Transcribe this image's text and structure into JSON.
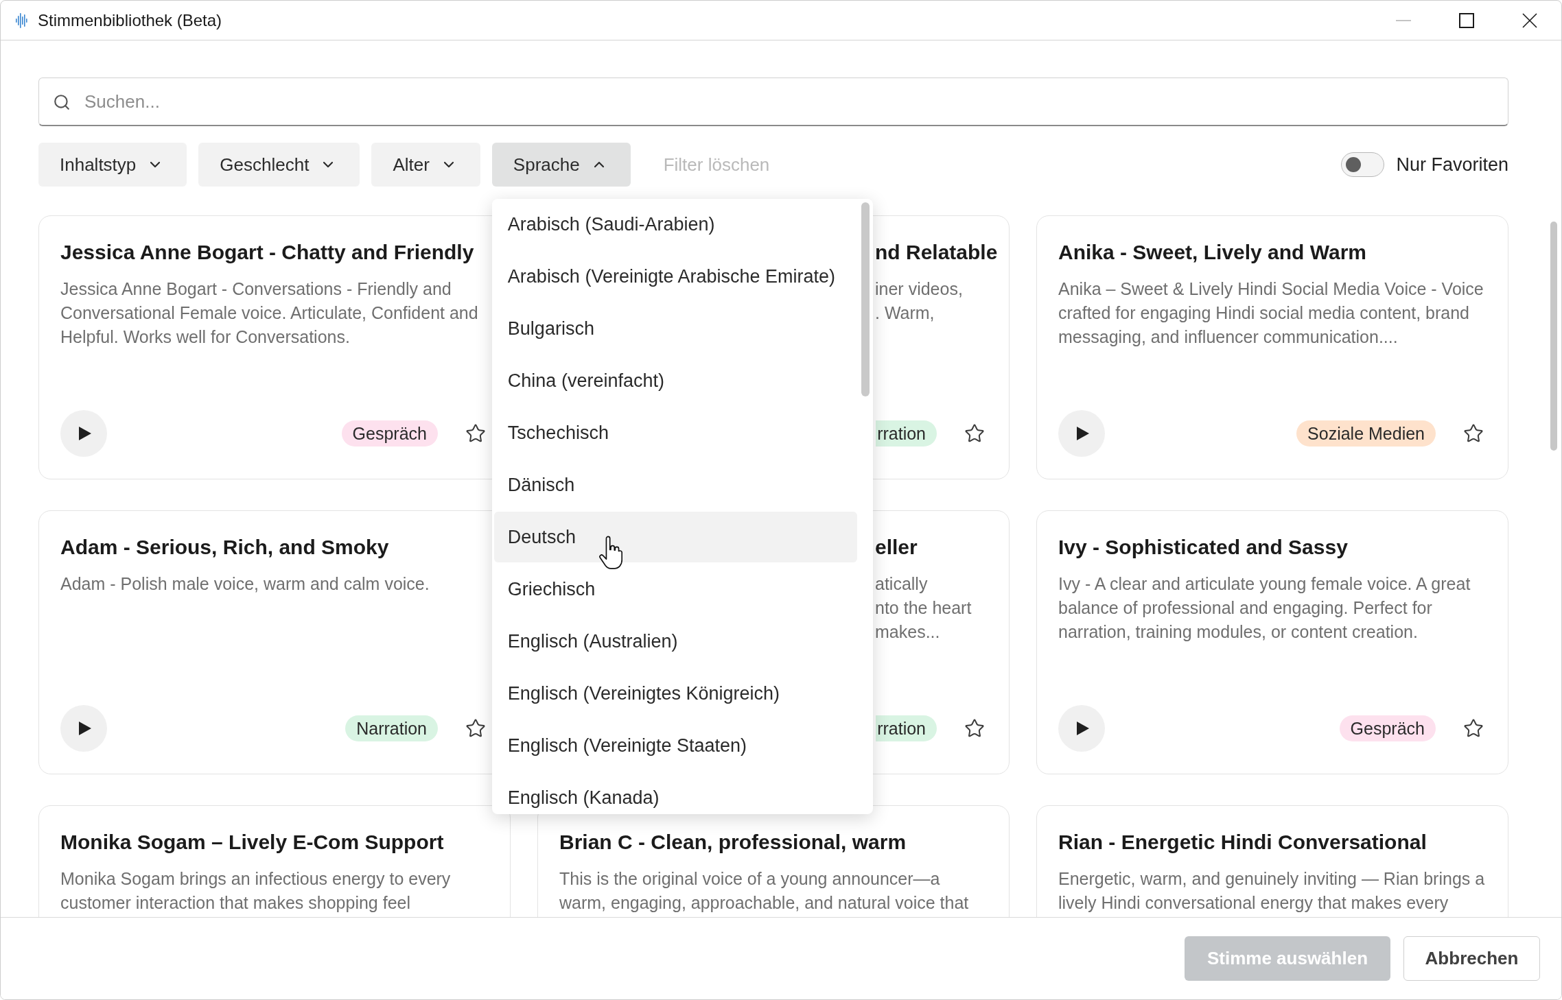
{
  "window": {
    "title": "Stimmenbibliothek (Beta)"
  },
  "search": {
    "placeholder": "Suchen..."
  },
  "filters": [
    {
      "label": "Inhaltstyp",
      "expanded": false
    },
    {
      "label": "Geschlecht",
      "expanded": false
    },
    {
      "label": "Alter",
      "expanded": false
    },
    {
      "label": "Sprache",
      "expanded": true
    }
  ],
  "clear_filters": {
    "label": "Filter löschen",
    "disabled": true
  },
  "favorites_toggle": {
    "label": "Nur Favoriten",
    "on": false
  },
  "language_menu": {
    "items": [
      {
        "label": "Arabisch (Saudi-Arabien)",
        "highlighted": false
      },
      {
        "label": "Arabisch (Vereinigte Arabische Emirate)",
        "highlighted": false
      },
      {
        "label": "Bulgarisch",
        "highlighted": false
      },
      {
        "label": "China (vereinfacht)",
        "highlighted": false
      },
      {
        "label": "Tschechisch",
        "highlighted": false
      },
      {
        "label": "Dänisch",
        "highlighted": false
      },
      {
        "label": "Deutsch",
        "highlighted": true
      },
      {
        "label": "Griechisch",
        "highlighted": false
      },
      {
        "label": "Englisch (Australien)",
        "highlighted": false
      },
      {
        "label": "Englisch (Vereinigtes Königreich)",
        "highlighted": false
      },
      {
        "label": "Englisch (Vereinigte Staaten)",
        "highlighted": false
      },
      {
        "label": "Englisch (Kanada)",
        "highlighted": false
      }
    ]
  },
  "cards": [
    {
      "kind": "full",
      "title": "Jessica Anne Bogart - Chatty and Friendly",
      "description": "Jessica Anne Bogart - Conversations - Friendly and Conversational Female voice. Articulate, Confident and Helpful. Works well for Conversations.",
      "tag": {
        "label": "Gespräch",
        "color": "#fde1ee"
      },
      "favorite": false
    },
    {
      "kind": "covered",
      "title": "nd Relatable",
      "description_lines": [
        "iner videos,",
        ". Warm,"
      ],
      "tag": {
        "label": "rration",
        "color": "#d9f4e3"
      },
      "favorite": false
    },
    {
      "kind": "full",
      "title": "Anika - Sweet, Lively and Warm",
      "description": "Anika – Sweet & Lively Hindi Social Media Voice - Voice crafted for engaging Hindi social media content, brand messaging, and influencer communication....",
      "tag": {
        "label": "Soziale Medien",
        "color": "#fee2cc"
      },
      "favorite": false
    },
    {
      "kind": "full",
      "title": "Adam - Serious, Rich, and Smoky",
      "description": "Adam - Polish male voice, warm and calm voice.",
      "tag": {
        "label": "Narration",
        "color": "#d9f4e3"
      },
      "favorite": false
    },
    {
      "kind": "covered",
      "title": "eller",
      "description_lines": [
        "atically",
        "nto the heart",
        "makes..."
      ],
      "tag": {
        "label": "rration",
        "color": "#d9f4e3"
      },
      "favorite": false
    },
    {
      "kind": "full",
      "title": "Ivy - Sophisticated and Sassy",
      "description": "Ivy - A clear and articulate young female voice. A great balance of professional and engaging. Perfect for narration, training modules, or content creation.",
      "tag": {
        "label": "Gespräch",
        "color": "#fde1ee"
      },
      "favorite": false
    },
    {
      "kind": "full",
      "title": "Monika Sogam – Lively E-Com Support",
      "description": "Monika Sogam brings an infectious energy to every customer interaction that makes shopping feel"
    },
    {
      "kind": "full",
      "title": "Brian C - Clean, professional, warm",
      "description": "This is the original voice of a young announcer—a warm, engaging, approachable, and natural voice that"
    },
    {
      "kind": "full",
      "title": "Rian - Energetic Hindi Conversational",
      "description": "Energetic, warm, and genuinely inviting — Rian brings a lively Hindi conversational energy that makes every"
    }
  ],
  "footer": {
    "buttons": [
      {
        "label": "Stimme auswählen",
        "kind": "primary",
        "disabled": true
      },
      {
        "label": "Abbrechen",
        "kind": "secondary",
        "disabled": false
      }
    ]
  }
}
